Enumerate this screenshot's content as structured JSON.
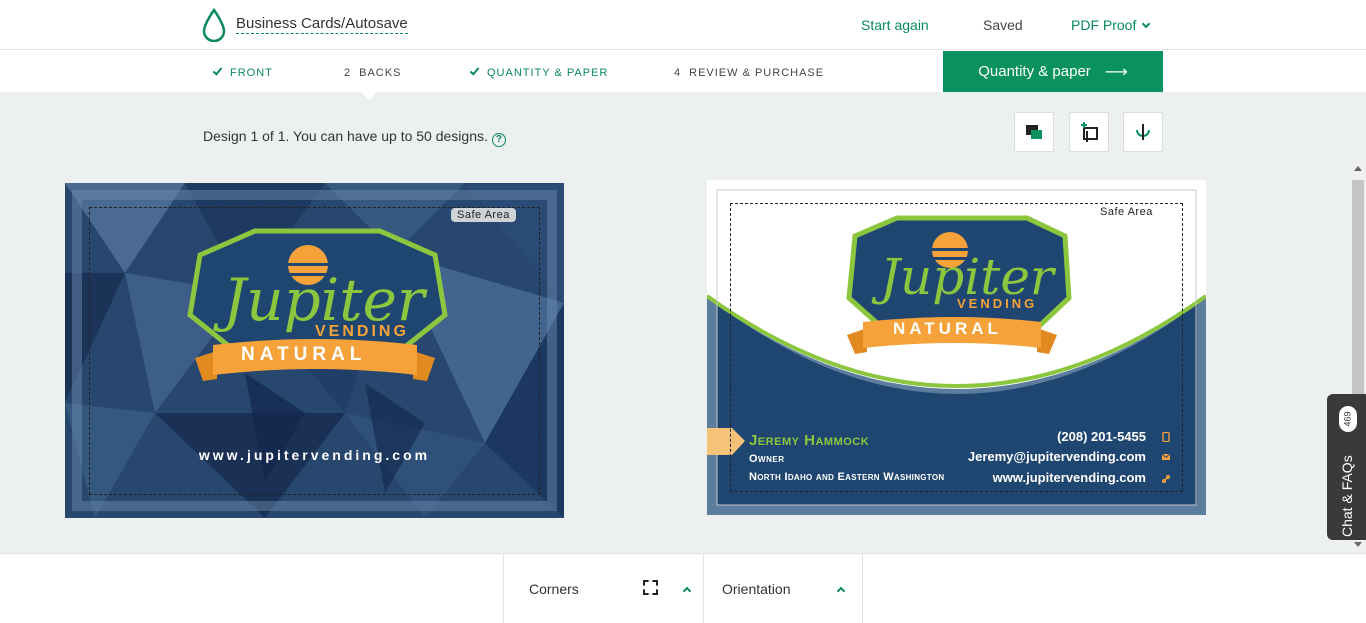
{
  "header": {
    "title": "Business Cards/Autosave",
    "start_again": "Start again",
    "saved": "Saved",
    "pdf_proof": "PDF Proof"
  },
  "steps": [
    {
      "num": "",
      "label": "FRONT",
      "state": "done"
    },
    {
      "num": "2",
      "label": "BACKS",
      "state": "current"
    },
    {
      "num": "",
      "label": "QUANTITY & PAPER",
      "state": "done"
    },
    {
      "num": "4",
      "label": "REVIEW & PURCHASE",
      "state": "todo"
    }
  ],
  "cta": {
    "label": "Quantity & paper",
    "arrow": "⟶"
  },
  "design_info": "Design 1 of 1. You can have up to 50 designs.",
  "help": "?",
  "tools": [
    "duplicate-design-icon",
    "add-design-icon",
    "rotate-icon"
  ],
  "front_card": {
    "safe_area": "Safe Area",
    "logo_word": "Jupiter",
    "logo_sub": "VENDING",
    "banner": "NATURAL",
    "url": "www.jupitervending.com"
  },
  "back_card": {
    "safe_area": "Safe Area",
    "logo_word": "Jupiter",
    "logo_sub": "VENDING",
    "banner": "NATURAL",
    "name": "Jeremy Hammock",
    "role": "Owner",
    "region": "North Idaho and Eastern Washington",
    "phone": "(208) 201-5455",
    "email": "Jeremy@jupitervending.com",
    "web": "www.jupitervending.com"
  },
  "chat": {
    "label": "Chat & FAQs",
    "badge": "469"
  },
  "bottom": {
    "corners": "Corners",
    "orientation": "Orientation"
  },
  "colors": {
    "brand_green": "#0a9160",
    "navy": "#1f4670",
    "lime": "#8cc63f",
    "orange": "#f5a23a"
  }
}
